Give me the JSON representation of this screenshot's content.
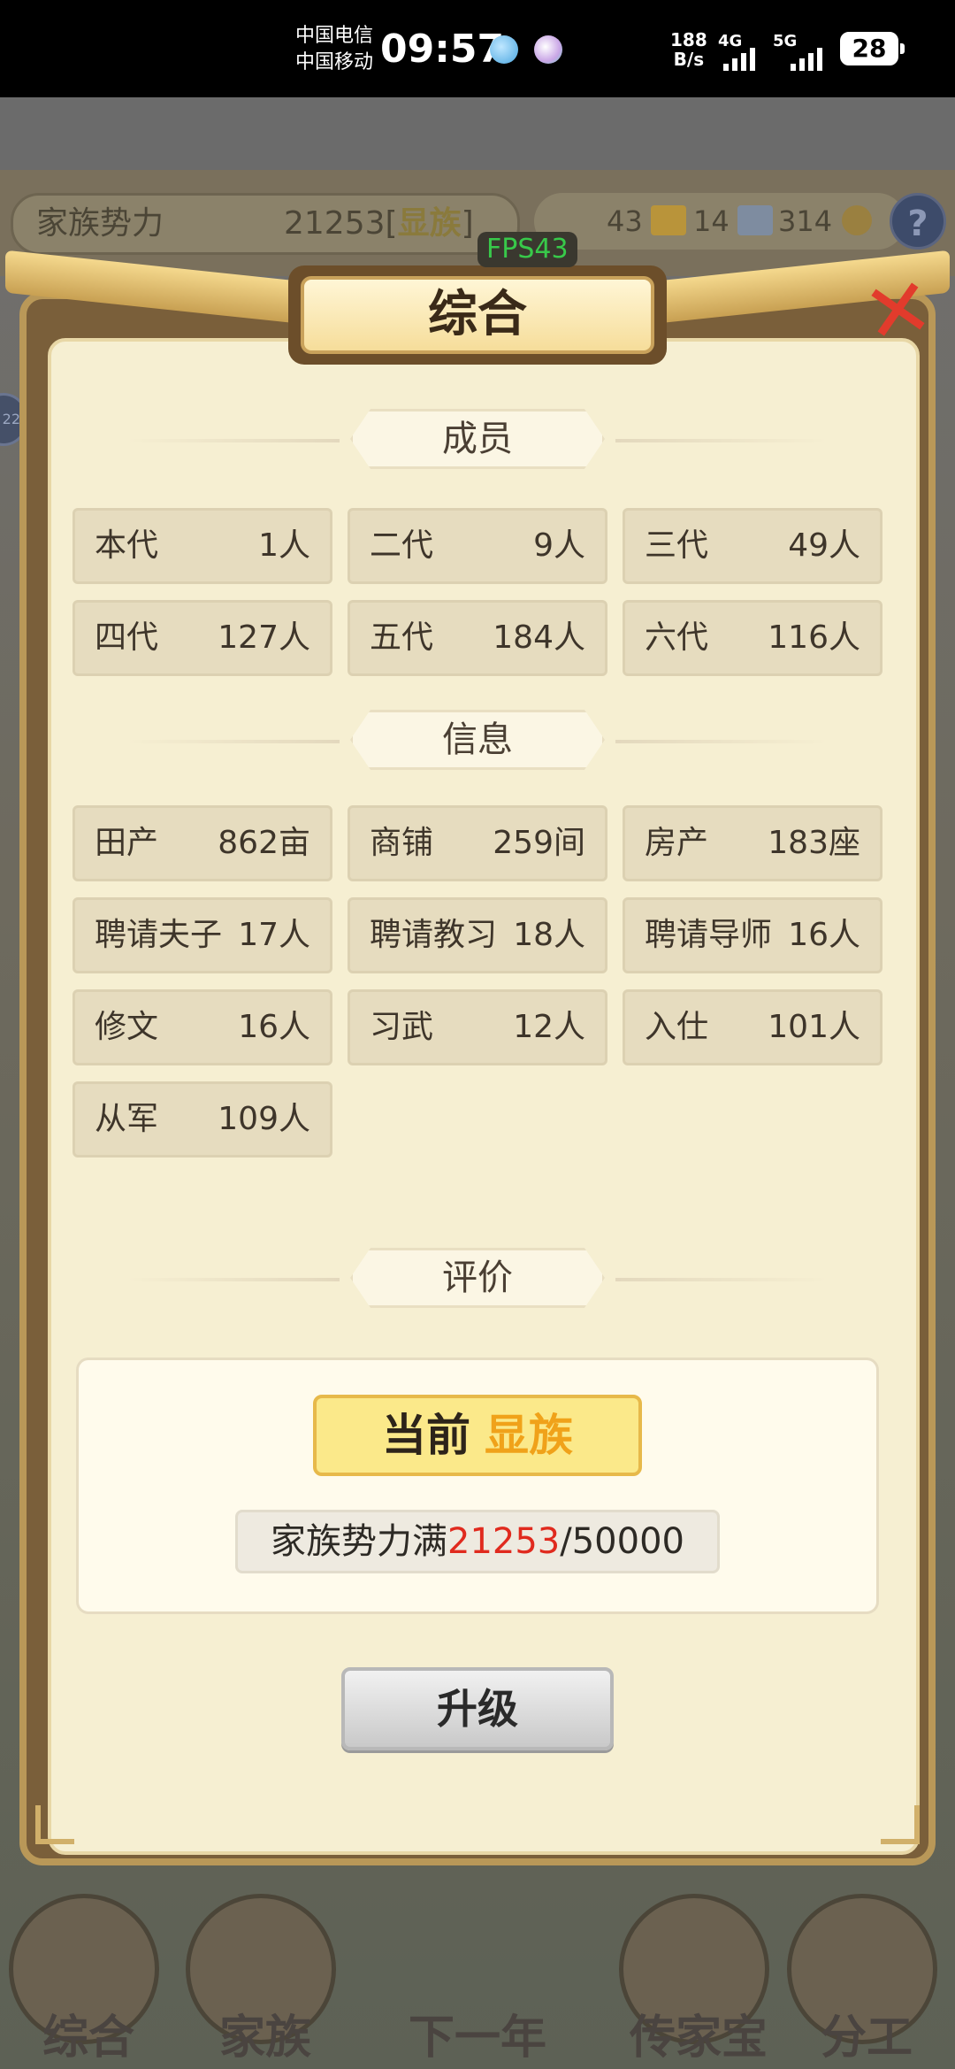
{
  "status_bar": {
    "carrier1": "中国电信",
    "carrier2": "中国移动",
    "time": "09:57",
    "speed_value": "188",
    "speed_unit": "B/s",
    "net1": "4G",
    "net2": "5G",
    "battery": "28"
  },
  "hud": {
    "power_label": "家族势力",
    "power_value": "21253",
    "power_rank": "显族",
    "res1": "43",
    "res2": "14",
    "res3": "314",
    "help": "?",
    "fps": "FPS43",
    "side_badge": "22"
  },
  "dialog": {
    "title": "综合",
    "close_glyph": "✕",
    "members_title": "成员",
    "members": [
      {
        "label": "本代",
        "value": "1人"
      },
      {
        "label": "二代",
        "value": "9人"
      },
      {
        "label": "三代",
        "value": "49人"
      },
      {
        "label": "四代",
        "value": "127人"
      },
      {
        "label": "五代",
        "value": "184人"
      },
      {
        "label": "六代",
        "value": "116人"
      }
    ],
    "info_title": "信息",
    "info": [
      {
        "label": "田产",
        "value": "862亩"
      },
      {
        "label": "商铺",
        "value": "259间"
      },
      {
        "label": "房产",
        "value": "183座"
      },
      {
        "label": "聘请夫子",
        "value": "17人"
      },
      {
        "label": "聘请教习",
        "value": "18人"
      },
      {
        "label": "聘请导师",
        "value": "16人"
      },
      {
        "label": "修文",
        "value": "16人"
      },
      {
        "label": "习武",
        "value": "12人"
      },
      {
        "label": "入仕",
        "value": "101人"
      },
      {
        "label": "从军",
        "value": "109人"
      }
    ],
    "eval_title": "评价",
    "eval": {
      "current_label": "当前",
      "current_rank": "显族",
      "power_prefix": "家族势力满",
      "power_current": "21253",
      "power_target": "/50000"
    },
    "upgrade_label": "升级"
  },
  "bottom_nav": [
    "综合",
    "家族",
    "下一年",
    "传家宝",
    "分工"
  ],
  "colors": {
    "dialog_bg": "#f6efd2",
    "cell_bg": "#e6dcbf",
    "rank_gold": "#f0a21a",
    "power_red": "#e02a1e",
    "fps_green": "#38c94a"
  }
}
